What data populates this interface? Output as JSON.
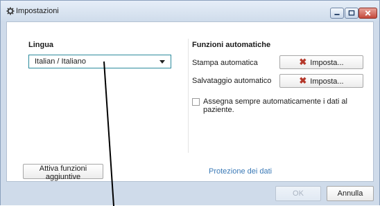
{
  "window": {
    "title": "Impostazioni"
  },
  "language": {
    "title": "Lingua",
    "selected": "Italian / Italiano"
  },
  "auto": {
    "title": "Funzioni automatiche",
    "print_label": "Stampa automatica",
    "save_label": "Salvataggio automatico",
    "set_button": "Imposta...",
    "assign_label": "Assegna sempre automaticamente i dati al paziente.",
    "assign_checked": false
  },
  "extra_button": "Attiva funzioni aggiuntive",
  "privacy_link": "Protezione dei dati",
  "footer": {
    "ok": "OK",
    "cancel": "Annulla"
  },
  "colors": {
    "accent": "#2b8a9c",
    "link": "#3a79b6",
    "close_red": "#c4493c",
    "cross_red": "#b5382b"
  }
}
